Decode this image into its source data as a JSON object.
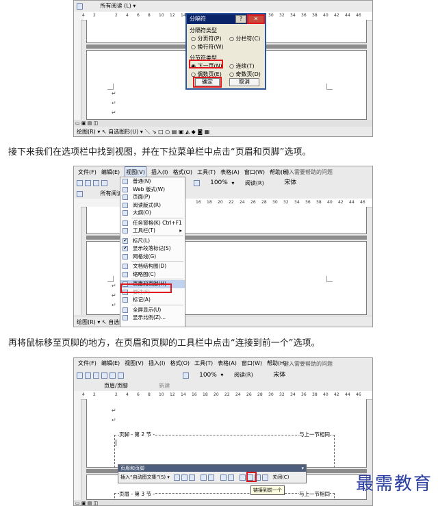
{
  "captions": {
    "step1": "接下来我们在选项栏中找到视图，并在下拉菜单栏中点击“页眉和页脚”选项。",
    "step2": "再将鼠标移至页脚的地方，在页眉和页脚的工具栏中点击“连接到前一个”选项。"
  },
  "shot1": {
    "style_label": "所有阅读 (L) ▾",
    "ruler_ticks": [
      "4",
      "2",
      "",
      "2",
      "4",
      "6",
      "8",
      "10",
      "12",
      "14",
      "16",
      "18",
      "20",
      "22",
      "24",
      "26",
      "28",
      "30",
      "32",
      "34",
      "36",
      "38",
      "40",
      "42",
      "44",
      "46"
    ],
    "dialog": {
      "title": "分隔符",
      "help": "?",
      "close": "✕",
      "group1_label": "分隔符类型",
      "opt_page": "分页符(P)",
      "opt_column": "分栏符(C)",
      "opt_wrap": "换行符(W)",
      "group2_label": "分节符类型",
      "opt_next": "下一页(N)",
      "opt_cont": "连续(T)",
      "opt_even": "偶数页(E)",
      "opt_odd": "奇数页(D)",
      "ok": "确定",
      "cancel": "取消"
    },
    "draw_toolbar": "绘图(R) ▾  ↖  自选图形(U) ▾  ＼  ↘  □  ○  ▤  ▣  ◭  ◆  ◙  ▦"
  },
  "shot2": {
    "menubar": [
      "文件(F)",
      "编辑(E)",
      "视图(V)",
      "插入(I)",
      "格式(O)",
      "工具(T)",
      "表格(A)",
      "窗口(W)",
      "帮助(H)"
    ],
    "help_box": "键入需要帮助的问题",
    "zoom": "100%",
    "read": "阅读(R)",
    "font": "宋体",
    "style_label": "所有阅读",
    "view_menu": [
      {
        "label": "普通(N)"
      },
      {
        "label": "Web 版式(W)"
      },
      {
        "label": "页面(P)"
      },
      {
        "label": "阅读版式(R)"
      },
      {
        "label": "大纲(O)"
      },
      {
        "label": "任务窗格(K)    Ctrl+F1"
      },
      {
        "label": "工具栏(T)"
      },
      {
        "label": "标尺(L)"
      },
      {
        "label": "显示段落标记(S)"
      },
      {
        "label": "网格线(G)"
      },
      {
        "label": "文档结构图(D)"
      },
      {
        "label": "缩略图(C)"
      },
      {
        "label": "页眉和页脚(H)"
      },
      {
        "label": "脚注(F)"
      },
      {
        "label": "标记(A)"
      },
      {
        "label": "全屏显示(U)"
      },
      {
        "label": "显示比例(Z)..."
      }
    ],
    "ruler_ticks": [
      "16",
      "18",
      "20",
      "22",
      "24",
      "26",
      "28",
      "30",
      "32",
      "34",
      "36",
      "38",
      "40",
      "42",
      "44",
      "46"
    ],
    "draw_toolbar": "绘图(R) ▾  ↖  自选图形(U) ▾"
  },
  "shot3": {
    "menubar": [
      "文件(F)",
      "编辑(E)",
      "视图(V)",
      "插入(I)",
      "格式(O)",
      "工具(T)",
      "表格(A)",
      "窗口(W)",
      "帮助(H)"
    ],
    "help_box": "键入需要帮助的问题",
    "zoom": "100%",
    "read": "阅读(R)",
    "font": "宋体",
    "style_label": "页眉/页脚",
    "new_label": "新建",
    "ruler_ticks": [
      "4",
      "2",
      "",
      "2",
      "4",
      "6",
      "8",
      "10",
      "12",
      "14",
      "16",
      "18",
      "20",
      "22",
      "24",
      "26",
      "28",
      "30",
      "32",
      "34",
      "36",
      "38",
      "40",
      "42",
      "44",
      "46"
    ],
    "footer_label": "页脚 - 第 2 节 -",
    "same_as_prev": "与上一节相同",
    "header_label": "页眉 - 第 3 节 -",
    "hf_toolbar_title": "页眉和页脚",
    "insert_autotext": "插入“自动图文集”(S) ▾",
    "close": "关闭(C)",
    "tooltip": "链接到前一个"
  },
  "brand": "最需教育"
}
